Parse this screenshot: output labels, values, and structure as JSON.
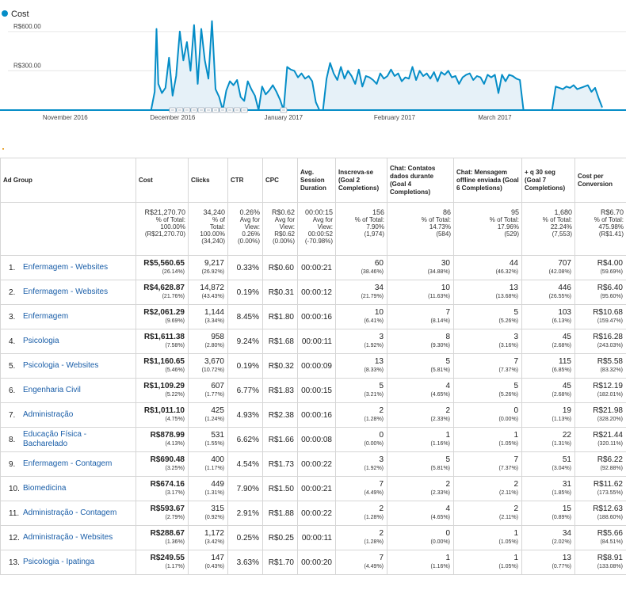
{
  "chart_data": {
    "type": "area",
    "legend": "Cost",
    "color": "#058dc7",
    "ylabels": [
      "R$600.00",
      "R$300.00"
    ],
    "yticks": [
      600,
      300
    ],
    "ylim": [
      0,
      720
    ],
    "xlabels": [
      "November 2016",
      "December 2016",
      "January 2017",
      "February 2017",
      "March 2017"
    ],
    "xlabel_days": [
      16,
      46,
      77,
      108,
      136
    ],
    "annotation_days": [
      46,
      48,
      50,
      52,
      54,
      56,
      58,
      60,
      62,
      64,
      66,
      77
    ],
    "x_start": "2016-11-01",
    "x_end": "2017-04-15",
    "days": [
      0,
      20,
      40,
      41,
      41.5,
      42,
      43,
      44,
      45,
      46,
      47,
      48,
      49,
      50,
      51,
      52,
      53,
      54,
      55,
      56,
      57,
      58,
      59,
      60,
      61,
      62,
      63,
      64,
      65,
      66,
      67,
      68,
      69,
      70,
      71,
      72,
      73,
      74,
      75,
      76,
      77,
      78,
      79,
      80,
      81,
      82,
      83,
      84,
      85,
      86,
      87,
      88,
      89,
      90,
      91,
      92,
      93,
      94,
      95,
      96,
      97,
      98,
      99,
      100,
      101,
      102,
      103,
      104,
      105,
      106,
      107,
      108,
      109,
      110,
      111,
      112,
      113,
      114,
      115,
      116,
      117,
      118,
      119,
      120,
      121,
      122,
      123,
      124,
      125,
      126,
      127,
      128,
      129,
      130,
      131,
      132,
      133,
      134,
      135,
      136,
      137,
      138,
      139,
      140,
      141,
      142,
      143,
      144,
      145,
      146,
      150,
      151,
      152,
      153,
      154,
      155,
      156,
      157,
      158,
      159,
      160,
      161,
      162,
      163,
      164,
      165,
      166
    ],
    "values": [
      0,
      0,
      0,
      140,
      620,
      200,
      130,
      170,
      400,
      110,
      260,
      600,
      380,
      520,
      300,
      650,
      200,
      620,
      380,
      240,
      680,
      160,
      100,
      0,
      150,
      220,
      190,
      230,
      100,
      70,
      220,
      160,
      110,
      0,
      180,
      120,
      150,
      190,
      140,
      80,
      0,
      330,
      310,
      300,
      250,
      280,
      240,
      260,
      220,
      60,
      0,
      0,
      240,
      360,
      280,
      230,
      330,
      240,
      300,
      260,
      200,
      310,
      180,
      260,
      250,
      230,
      200,
      280,
      240,
      260,
      310,
      260,
      280,
      220,
      250,
      240,
      330,
      230,
      300,
      260,
      280,
      240,
      290,
      220,
      290,
      270,
      300,
      250,
      260,
      200,
      250,
      270,
      280,
      230,
      260,
      250,
      200,
      270,
      250,
      270,
      130,
      270,
      220,
      270,
      260,
      240,
      230,
      0,
      0,
      0,
      0,
      0,
      0,
      180,
      170,
      160,
      180,
      170,
      190,
      160,
      170,
      180,
      190,
      140,
      170,
      90,
      20,
      0
    ]
  },
  "table": {
    "headers": {
      "ad_group": "Ad Group",
      "cost": "Cost",
      "clicks": "Clicks",
      "ctr": "CTR",
      "cpc": "CPC",
      "avg_session": "Avg. Session Duration",
      "goal2": "Inscreva-se (Goal 2 Completions)",
      "goal4": "Chat: Contatos dados durante (Goal 4 Completions)",
      "goal6": "Chat: Mensagem offline enviada (Goal 6 Completions)",
      "goal7": "+ q 30 seg (Goal 7 Completions)",
      "cpconv": "Cost per Conversion"
    },
    "totals": {
      "cost": [
        "R$21,270.70",
        "% of Total:",
        "100.00%",
        "(R$21,270.70)"
      ],
      "clicks": [
        "34,240",
        "% of",
        "Total:",
        "100.00%",
        "(34,240)"
      ],
      "ctr": [
        "0.26%",
        "Avg for",
        "View:",
        "0.26%",
        "(0.00%)"
      ],
      "cpc": [
        "R$0.62",
        "Avg for",
        "View:",
        "R$0.62",
        "(0.00%)"
      ],
      "avg_session": [
        "00:00:15",
        "Avg for",
        "View:",
        "00:00:52",
        "(-70.98%)"
      ],
      "goal2": [
        "156",
        "% of Total:",
        "7.90%",
        "(1,974)"
      ],
      "goal4": [
        "86",
        "% of Total:",
        "14.73%",
        "(584)"
      ],
      "goal6": [
        "95",
        "% of Total:",
        "17.96%",
        "(529)"
      ],
      "goal7": [
        "1,680",
        "% of Total:",
        "22.24%",
        "(7,553)"
      ],
      "cpconv": [
        "R$6.70",
        "% of Total:",
        "475.98%",
        "(R$1.41)"
      ]
    },
    "rows": [
      {
        "num": "1.",
        "name": "Enfermagem - Websites",
        "cost": "R$5,560.65",
        "cost_pct": "(26.14%)",
        "clicks": "9,217",
        "clicks_pct": "(26.92%)",
        "ctr": "0.33%",
        "cpc": "R$0.60",
        "dur": "00:00:21",
        "g2": "60",
        "g2_pct": "(38.46%)",
        "g4": "30",
        "g4_pct": "(34.88%)",
        "g6": "44",
        "g6_pct": "(46.32%)",
        "g7": "707",
        "g7_pct": "(42.08%)",
        "cpconv": "R$4.00",
        "cpconv_pct": "(59.69%)"
      },
      {
        "num": "2.",
        "name": "Enfermagem - Websites",
        "cost": "R$4,628.87",
        "cost_pct": "(21.76%)",
        "clicks": "14,872",
        "clicks_pct": "(43.43%)",
        "ctr": "0.19%",
        "cpc": "R$0.31",
        "dur": "00:00:12",
        "g2": "34",
        "g2_pct": "(21.79%)",
        "g4": "10",
        "g4_pct": "(11.63%)",
        "g6": "13",
        "g6_pct": "(13.68%)",
        "g7": "446",
        "g7_pct": "(26.55%)",
        "cpconv": "R$6.40",
        "cpconv_pct": "(95.60%)"
      },
      {
        "num": "3.",
        "name": "Enfermagem",
        "cost": "R$2,061.29",
        "cost_pct": "(9.69%)",
        "clicks": "1,144",
        "clicks_pct": "(3.34%)",
        "ctr": "8.45%",
        "cpc": "R$1.80",
        "dur": "00:00:16",
        "g2": "10",
        "g2_pct": "(6.41%)",
        "g4": "7",
        "g4_pct": "(8.14%)",
        "g6": "5",
        "g6_pct": "(5.26%)",
        "g7": "103",
        "g7_pct": "(6.13%)",
        "cpconv": "R$10.68",
        "cpconv_pct": "(159.47%)"
      },
      {
        "num": "4.",
        "name": "Psicologia",
        "cost": "R$1,611.38",
        "cost_pct": "(7.58%)",
        "clicks": "958",
        "clicks_pct": "(2.80%)",
        "ctr": "9.24%",
        "cpc": "R$1.68",
        "dur": "00:00:11",
        "g2": "3",
        "g2_pct": "(1.92%)",
        "g4": "8",
        "g4_pct": "(9.30%)",
        "g6": "3",
        "g6_pct": "(3.16%)",
        "g7": "45",
        "g7_pct": "(2.68%)",
        "cpconv": "R$16.28",
        "cpconv_pct": "(243.03%)"
      },
      {
        "num": "5.",
        "name": "Psicologia - Websites",
        "cost": "R$1,160.65",
        "cost_pct": "(5.46%)",
        "clicks": "3,670",
        "clicks_pct": "(10.72%)",
        "ctr": "0.19%",
        "cpc": "R$0.32",
        "dur": "00:00:09",
        "g2": "13",
        "g2_pct": "(8.33%)",
        "g4": "5",
        "g4_pct": "(5.81%)",
        "g6": "7",
        "g6_pct": "(7.37%)",
        "g7": "115",
        "g7_pct": "(6.85%)",
        "cpconv": "R$5.58",
        "cpconv_pct": "(83.32%)"
      },
      {
        "num": "6.",
        "name": "Engenharia Civil",
        "cost": "R$1,109.29",
        "cost_pct": "(5.22%)",
        "clicks": "607",
        "clicks_pct": "(1.77%)",
        "ctr": "6.77%",
        "cpc": "R$1.83",
        "dur": "00:00:15",
        "g2": "5",
        "g2_pct": "(3.21%)",
        "g4": "4",
        "g4_pct": "(4.65%)",
        "g6": "5",
        "g6_pct": "(5.26%)",
        "g7": "45",
        "g7_pct": "(2.68%)",
        "cpconv": "R$12.19",
        "cpconv_pct": "(182.01%)"
      },
      {
        "num": "7.",
        "name": "Administração",
        "cost": "R$1,011.10",
        "cost_pct": "(4.75%)",
        "clicks": "425",
        "clicks_pct": "(1.24%)",
        "ctr": "4.93%",
        "cpc": "R$2.38",
        "dur": "00:00:16",
        "g2": "2",
        "g2_pct": "(1.28%)",
        "g4": "2",
        "g4_pct": "(2.33%)",
        "g6": "0",
        "g6_pct": "(0.00%)",
        "g7": "19",
        "g7_pct": "(1.13%)",
        "cpconv": "R$21.98",
        "cpconv_pct": "(328.20%)"
      },
      {
        "num": "8.",
        "name": "Educação Física - Bacharelado",
        "cost": "R$878.99",
        "cost_pct": "(4.13%)",
        "clicks": "531",
        "clicks_pct": "(1.55%)",
        "ctr": "6.62%",
        "cpc": "R$1.66",
        "dur": "00:00:08",
        "g2": "0",
        "g2_pct": "(0.00%)",
        "g4": "1",
        "g4_pct": "(1.16%)",
        "g6": "1",
        "g6_pct": "(1.05%)",
        "g7": "22",
        "g7_pct": "(1.31%)",
        "cpconv": "R$21.44",
        "cpconv_pct": "(320.11%)"
      },
      {
        "num": "9.",
        "name": "Enfermagem - Contagem",
        "cost": "R$690.48",
        "cost_pct": "(3.25%)",
        "clicks": "400",
        "clicks_pct": "(1.17%)",
        "ctr": "4.54%",
        "cpc": "R$1.73",
        "dur": "00:00:22",
        "g2": "3",
        "g2_pct": "(1.92%)",
        "g4": "5",
        "g4_pct": "(5.81%)",
        "g6": "7",
        "g6_pct": "(7.37%)",
        "g7": "51",
        "g7_pct": "(3.04%)",
        "cpconv": "R$6.22",
        "cpconv_pct": "(92.88%)"
      },
      {
        "num": "10.",
        "name": "Biomedicina",
        "cost": "R$674.16",
        "cost_pct": "(3.17%)",
        "clicks": "449",
        "clicks_pct": "(1.31%)",
        "ctr": "7.90%",
        "cpc": "R$1.50",
        "dur": "00:00:21",
        "g2": "7",
        "g2_pct": "(4.49%)",
        "g4": "2",
        "g4_pct": "(2.33%)",
        "g6": "2",
        "g6_pct": "(2.11%)",
        "g7": "31",
        "g7_pct": "(1.85%)",
        "cpconv": "R$11.62",
        "cpconv_pct": "(173.55%)"
      },
      {
        "num": "11.",
        "name": "Administração - Contagem",
        "cost": "R$593.67",
        "cost_pct": "(2.79%)",
        "clicks": "315",
        "clicks_pct": "(0.92%)",
        "ctr": "2.91%",
        "cpc": "R$1.88",
        "dur": "00:00:22",
        "g2": "2",
        "g2_pct": "(1.28%)",
        "g4": "4",
        "g4_pct": "(4.65%)",
        "g6": "2",
        "g6_pct": "(2.11%)",
        "g7": "15",
        "g7_pct": "(0.89%)",
        "cpconv": "R$12.63",
        "cpconv_pct": "(188.60%)"
      },
      {
        "num": "12.",
        "name": "Administração - Websites",
        "cost": "R$288.67",
        "cost_pct": "(1.36%)",
        "clicks": "1,172",
        "clicks_pct": "(3.42%)",
        "ctr": "0.25%",
        "cpc": "R$0.25",
        "dur": "00:00:11",
        "g2": "2",
        "g2_pct": "(1.28%)",
        "g4": "0",
        "g4_pct": "(0.00%)",
        "g6": "1",
        "g6_pct": "(1.05%)",
        "g7": "34",
        "g7_pct": "(2.02%)",
        "cpconv": "R$5.66",
        "cpconv_pct": "(84.51%)"
      },
      {
        "num": "13.",
        "name": "Psicologia - Ipatinga",
        "cost": "R$249.55",
        "cost_pct": "(1.17%)",
        "clicks": "147",
        "clicks_pct": "(0.43%)",
        "ctr": "3.63%",
        "cpc": "R$1.70",
        "dur": "00:00:20",
        "g2": "7",
        "g2_pct": "(4.49%)",
        "g4": "1",
        "g4_pct": "(1.16%)",
        "g6": "1",
        "g6_pct": "(1.05%)",
        "g7": "13",
        "g7_pct": "(0.77%)",
        "cpconv": "R$8.91",
        "cpconv_pct": "(133.08%)"
      }
    ]
  }
}
